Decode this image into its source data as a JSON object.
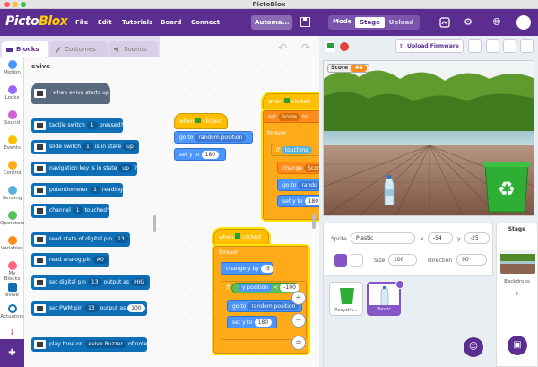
{
  "window": {
    "title": "PictoBlox"
  },
  "brand": {
    "part1": "Picto",
    "part2": "Blox"
  },
  "menu": {
    "file": "File",
    "edit": "Edit",
    "tutorials": "Tutorials",
    "board": "Board",
    "connect": "Connect",
    "project_title": "Automa...",
    "mode_label": "Mode",
    "mode_stage": "Stage",
    "mode_upload": "Upload"
  },
  "tabs": {
    "blocks": "Blocks",
    "costumes": "Costumes",
    "sounds": "Sounds"
  },
  "categories": [
    {
      "label": "Motion",
      "color": "#4c97ff"
    },
    {
      "label": "Looks",
      "color": "#9966ff"
    },
    {
      "label": "Sound",
      "color": "#cf63cf"
    },
    {
      "label": "Events",
      "color": "#ffbf00"
    },
    {
      "label": "Control",
      "color": "#ffab19"
    },
    {
      "label": "Sensing",
      "color": "#5cb1d6"
    },
    {
      "label": "Operators",
      "color": "#59c059"
    },
    {
      "label": "Variables",
      "color": "#ff8c1a"
    },
    {
      "label": "My Blocks",
      "color": "#ff6680"
    },
    {
      "label": "evive",
      "color": "#0f6fb6"
    },
    {
      "label": "Actuators",
      "color": "#0f6fb6"
    }
  ],
  "palette": {
    "title": "evive",
    "hat": "when evive starts up",
    "blocks": [
      {
        "pre": "tactile switch",
        "dd": "1",
        "post": "pressed?"
      },
      {
        "pre": "slide switch",
        "dd": "1",
        "post": "is in state",
        "dd2": "up"
      },
      {
        "pre": "navigation key is in state",
        "dd": "up",
        "post": "?"
      },
      {
        "pre": "potentiometer",
        "dd": "1",
        "post": "reading"
      },
      {
        "pre": "channel",
        "dd": "1",
        "post": "touched?"
      },
      {
        "pre": "read state of digital pin",
        "dd": "13",
        "post": ""
      },
      {
        "pre": "read analog pin",
        "dd": "A0",
        "post": ""
      },
      {
        "pre": "set digital pin",
        "dd": "13",
        "post": "output as",
        "dd2": "HIG"
      },
      {
        "pre": "set PWM pin",
        "dd": "13",
        "post": "output as",
        "num": "100"
      },
      {
        "pre": "play tone on",
        "dd": "evive Buzzer",
        "post": "of note"
      }
    ]
  },
  "scripts": {
    "s1": {
      "when": "when",
      "clicked": "clicked",
      "goto": "go to",
      "goto_dd": "random position",
      "sety": "set y to",
      "sety_val": "180"
    },
    "s2": {
      "when": "when",
      "clicked": "clicked",
      "set": "set",
      "set_dd": "Score",
      "set_to": "to",
      "forever": "forever",
      "if": "if",
      "touching": "touching",
      "change": "change",
      "change_dd": "Scor",
      "goto": "go to",
      "goto_dd": "rando",
      "sety": "set y to",
      "sety_val": "180"
    },
    "s3": {
      "when": "when",
      "clicked": "clicked",
      "forever": "forever",
      "change": "change y by",
      "change_val": "-5",
      "if": "if",
      "ypos": "y position",
      "lt": "<",
      "lt_val": "-100",
      "then": "then",
      "goto": "go to",
      "goto_dd": "random position",
      "sety": "set y to",
      "sety_val": "180"
    }
  },
  "stage_header": {
    "upload_firmware": "Upload Firmware"
  },
  "stage": {
    "score_label": "Score",
    "score_value": "44"
  },
  "sprite": {
    "label_sprite": "Sprite",
    "name": "Plastic",
    "label_x": "x",
    "x": "-54",
    "label_y": "y",
    "y": "-25",
    "label_size": "Size",
    "size": "100",
    "label_direction": "Direction",
    "direction": "90",
    "thumbs": [
      {
        "name": "Recyclin..."
      },
      {
        "name": "Plastic"
      }
    ]
  },
  "stage_panel": {
    "title": "Stage",
    "backdrops_label": "Backdrops",
    "backdrops_count": "2"
  },
  "colors": {
    "brand_purple": "#5c2d91",
    "evive_blue": "#0f6fb6",
    "accent_yellow": "#ffd000"
  }
}
